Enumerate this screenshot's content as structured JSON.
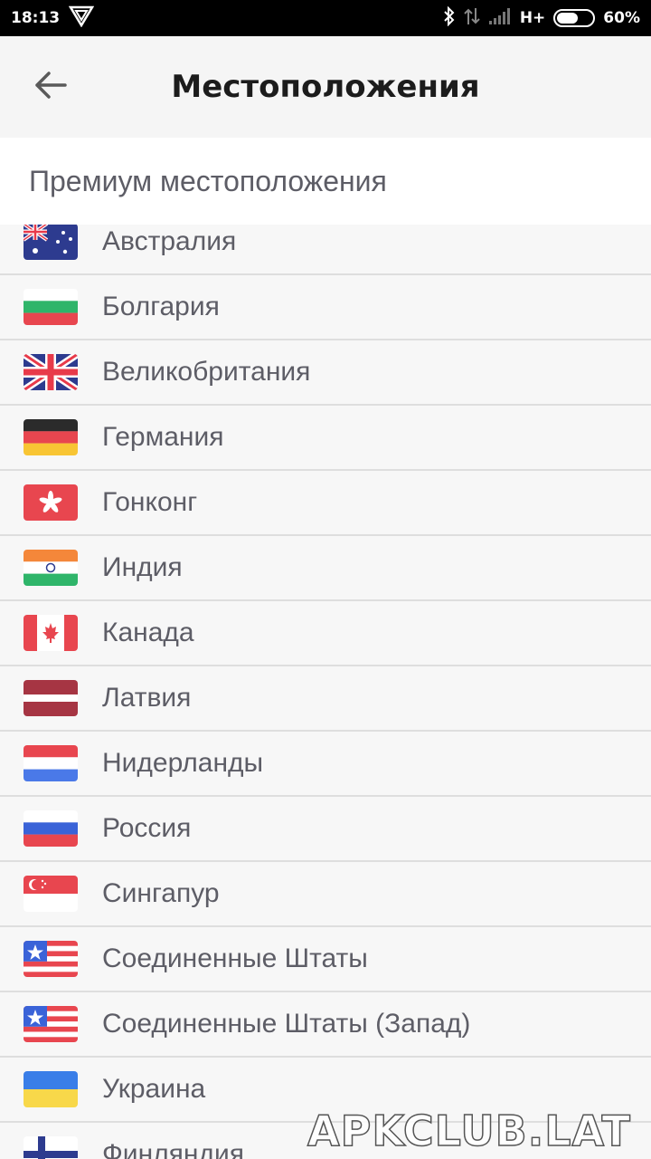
{
  "status_bar": {
    "time": "18:13",
    "network": "H+",
    "battery": "60%",
    "battery_level": 0.6
  },
  "app_bar": {
    "title": "Местоположения",
    "back_icon": "arrow-left-icon"
  },
  "section": {
    "title": "Премиум местоположения"
  },
  "locations": [
    {
      "name": "Австралия",
      "flag": "au"
    },
    {
      "name": "Болгария",
      "flag": "bg"
    },
    {
      "name": "Великобритания",
      "flag": "gb"
    },
    {
      "name": "Германия",
      "flag": "de"
    },
    {
      "name": "Гонконг",
      "flag": "hk"
    },
    {
      "name": "Индия",
      "flag": "in"
    },
    {
      "name": "Канада",
      "flag": "ca"
    },
    {
      "name": "Латвия",
      "flag": "lv"
    },
    {
      "name": "Нидерланды",
      "flag": "nl"
    },
    {
      "name": "Россия",
      "flag": "ru"
    },
    {
      "name": "Сингапур",
      "flag": "sg"
    },
    {
      "name": "Соединенные Штаты",
      "flag": "us"
    },
    {
      "name": "Соединенные Штаты (Запад)",
      "flag": "us"
    },
    {
      "name": "Украина",
      "flag": "ua"
    },
    {
      "name": "Финляндия",
      "flag": "fi"
    }
  ],
  "watermark": "APKCLUB.LAT",
  "colors": {
    "status_bar_bg": "#000000",
    "text_primary": "#1c1c1c",
    "text_secondary": "#5d5d66",
    "divider": "#dedede"
  }
}
